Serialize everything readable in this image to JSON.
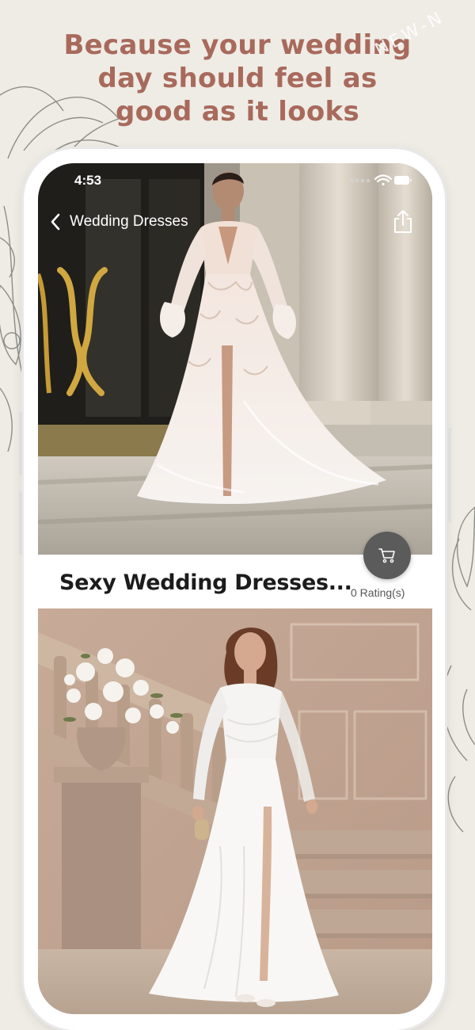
{
  "headline": {
    "line1": "Because your wedding",
    "line2": "day should feel as",
    "line3": "good as it looks"
  },
  "watermark_text": "NEW-N",
  "status_bar": {
    "time": "4:53"
  },
  "nav": {
    "back_label": "Wedding Dresses"
  },
  "product": {
    "title": "Sexy Wedding Dresses...",
    "rating": "0 Rating(s)"
  },
  "icons": {
    "back": "chevron-left-icon",
    "share": "share-icon",
    "cart": "cart-icon",
    "wifi": "wifi-icon",
    "battery": "battery-icon",
    "signal": "signal-icon"
  },
  "colors": {
    "background": "#efece6",
    "headline": "#a86a5c",
    "cart_button": "#5b5b5b"
  }
}
